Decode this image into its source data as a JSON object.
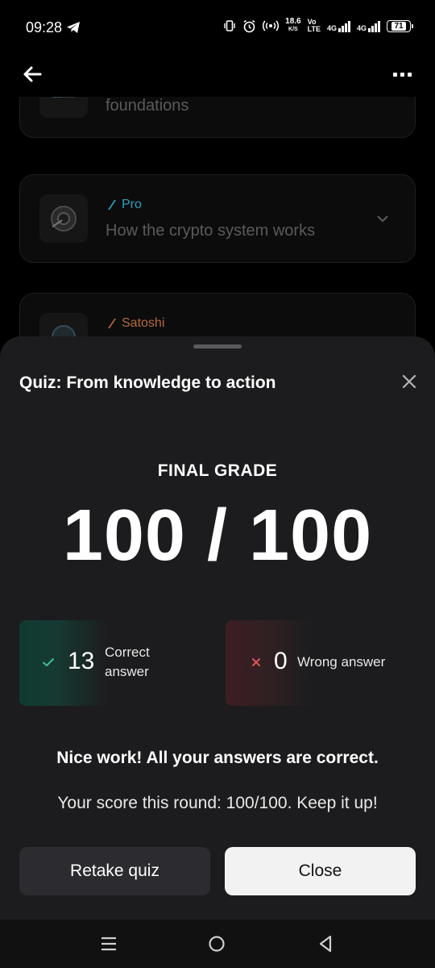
{
  "status_bar": {
    "time": "09:28",
    "net_speed_value": "18.6",
    "net_speed_unit": "K/S",
    "volte_top": "Vo",
    "volte_bottom": "LTE",
    "sim1_label": "4G",
    "sim2_label": "4G",
    "battery": "71"
  },
  "lessons": [
    {
      "tag": "",
      "tag_color": "",
      "title": "foundations"
    },
    {
      "tag": "Pro",
      "tag_color": "#2aa3c0",
      "title": "How the crypto system works"
    },
    {
      "tag": "Satoshi",
      "tag_color": "#b5693a",
      "title": ""
    }
  ],
  "sheet": {
    "title": "Quiz: From knowledge to action",
    "grade_label": "FINAL GRADE",
    "grade_value": "100 / 100",
    "correct": {
      "count": "13",
      "label": "Correct answer",
      "color": "#3fbf93"
    },
    "wrong": {
      "count": "0",
      "label": "Wrong answer",
      "color": "#e0535f"
    },
    "message_main": "Nice work! All your answers are correct.",
    "message_sub": "Your score this round: 100/100. Keep it up!",
    "retake_label": "Retake quiz",
    "close_label": "Close"
  }
}
